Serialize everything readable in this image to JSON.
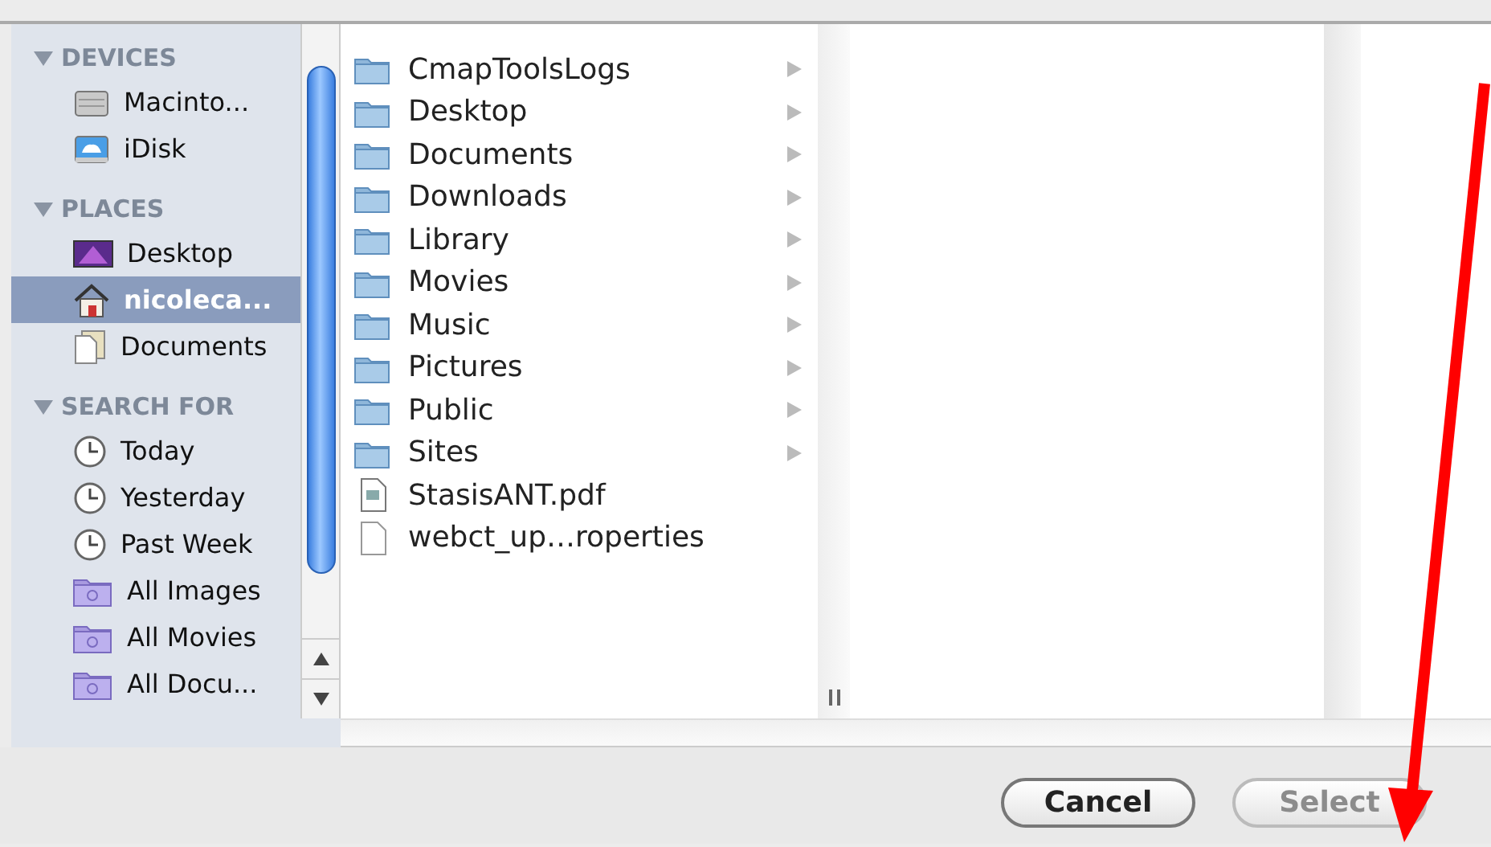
{
  "sidebar": {
    "sections": [
      {
        "title": "DEVICES",
        "expanded": true,
        "items": [
          {
            "label": "Macinto...",
            "kind": "drive",
            "selected": false
          },
          {
            "label": "iDisk",
            "kind": "idisk",
            "selected": false
          }
        ]
      },
      {
        "title": "PLACES",
        "expanded": true,
        "items": [
          {
            "label": "Desktop",
            "kind": "desktop",
            "selected": false
          },
          {
            "label": "nicoleca...",
            "kind": "home",
            "selected": true
          },
          {
            "label": "Documents",
            "kind": "documents",
            "selected": false
          }
        ]
      },
      {
        "title": "SEARCH FOR",
        "expanded": true,
        "items": [
          {
            "label": "Today",
            "kind": "clock",
            "selected": false
          },
          {
            "label": "Yesterday",
            "kind": "clock",
            "selected": false
          },
          {
            "label": "Past Week",
            "kind": "clock",
            "selected": false
          },
          {
            "label": "All Images",
            "kind": "smart-folder",
            "selected": false
          },
          {
            "label": "All Movies",
            "kind": "smart-folder",
            "selected": false
          },
          {
            "label": "All Docu...",
            "kind": "smart-folder",
            "selected": false
          }
        ]
      }
    ]
  },
  "files": [
    {
      "name": "CmapToolsLogs",
      "kind": "folder"
    },
    {
      "name": "Desktop",
      "kind": "folder"
    },
    {
      "name": "Documents",
      "kind": "folder"
    },
    {
      "name": "Downloads",
      "kind": "folder"
    },
    {
      "name": "Library",
      "kind": "folder"
    },
    {
      "name": "Movies",
      "kind": "folder"
    },
    {
      "name": "Music",
      "kind": "folder"
    },
    {
      "name": "Pictures",
      "kind": "folder"
    },
    {
      "name": "Public",
      "kind": "folder"
    },
    {
      "name": "Sites",
      "kind": "folder"
    },
    {
      "name": "StasisANT.pdf",
      "kind": "pdf"
    },
    {
      "name": "webct_up…roperties",
      "kind": "file"
    }
  ],
  "buttons": [
    {
      "label": "Cancel",
      "disabled": false
    },
    {
      "label": "Select",
      "disabled": true
    }
  ]
}
